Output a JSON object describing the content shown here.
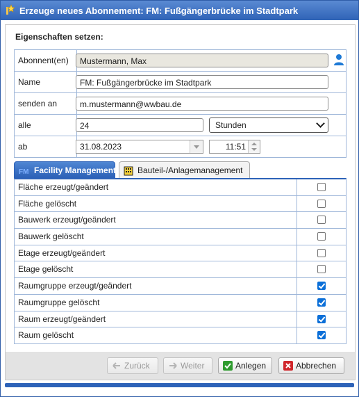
{
  "window": {
    "title": "Erzeuge neues Abonnement: FM: Fußgängerbrücke im Stadtpark"
  },
  "section_title": "Eigenschaften setzen:",
  "properties": {
    "subscriber_label": "Abonnent(en)",
    "subscriber_value": "Mustermann, Max",
    "name_label": "Name",
    "name_value": "FM: Fußgängerbrücke im Stadtpark",
    "send_to_label": "senden an",
    "send_to_value": "m.mustermann@wwbau.de",
    "every_label": "alle",
    "every_value": "24",
    "every_unit": "Stunden",
    "from_label": "ab",
    "from_date": "31.08.2023",
    "from_time": "11:51"
  },
  "tabs": [
    {
      "label": "Facility Management",
      "icon": "fm-icon",
      "active": true
    },
    {
      "label": "Bauteil-/Anlagemanagement",
      "icon": "building-icon",
      "active": false
    }
  ],
  "events": [
    {
      "label": "Fläche erzeugt/geändert",
      "checked": false
    },
    {
      "label": "Fläche gelöscht",
      "checked": false
    },
    {
      "label": "Bauwerk erzeugt/geändert",
      "checked": false
    },
    {
      "label": "Bauwerk gelöscht",
      "checked": false
    },
    {
      "label": "Etage erzeugt/geändert",
      "checked": false
    },
    {
      "label": "Etage gelöscht",
      "checked": false
    },
    {
      "label": "Raumgruppe erzeugt/geändert",
      "checked": true
    },
    {
      "label": "Raumgruppe gelöscht",
      "checked": true
    },
    {
      "label": "Raum erzeugt/geändert",
      "checked": true
    },
    {
      "label": "Raum gelöscht",
      "checked": true
    }
  ],
  "buttons": {
    "back": "Zurück",
    "next": "Weiter",
    "create": "Anlegen",
    "cancel": "Abbrechen"
  },
  "colors": {
    "accent": "#2d62b8",
    "checkbox_on": "#0b6fd8",
    "ok_green": "#2e9b2e",
    "cancel_red": "#d0262b"
  }
}
